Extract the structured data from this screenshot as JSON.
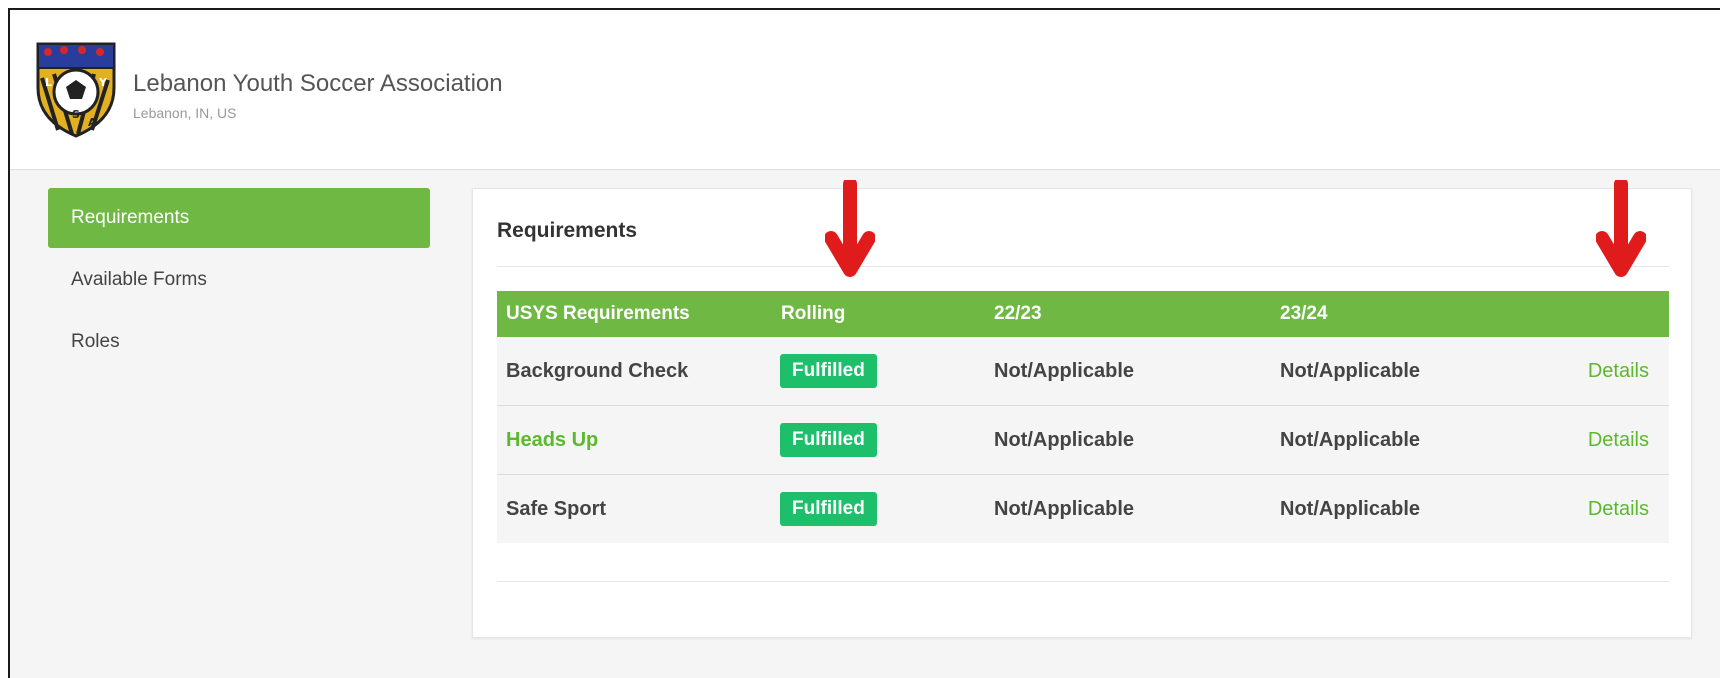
{
  "organization": {
    "name": "Lebanon Youth Soccer Association",
    "location": "Lebanon, IN, US",
    "logo_letters": [
      "L",
      "Y",
      "S",
      "A"
    ],
    "logo_icon": "soccer-ball-shield-icon"
  },
  "sidebar": {
    "items": [
      {
        "label": "Requirements",
        "active": true
      },
      {
        "label": "Available Forms",
        "active": false
      },
      {
        "label": "Roles",
        "active": false
      }
    ]
  },
  "panel": {
    "title": "Requirements",
    "table": {
      "headers": [
        "USYS Requirements",
        "Rolling",
        "22/23",
        "23/24",
        ""
      ],
      "rows": [
        {
          "name": "Background Check",
          "rolling": "Fulfilled",
          "s2223": "Not/Applicable",
          "s2324": "Not/Applicable",
          "action": "Details"
        },
        {
          "name": "Heads Up",
          "rolling": "Fulfilled",
          "s2223": "Not/Applicable",
          "s2324": "Not/Applicable",
          "action": "Details"
        },
        {
          "name": "Safe Sport",
          "rolling": "Fulfilled",
          "s2223": "Not/Applicable",
          "s2324": "Not/Applicable",
          "action": "Details"
        }
      ]
    }
  },
  "annotations": {
    "arrow_color": "#e01b1b",
    "arrow_icon": "down-arrow-icon"
  },
  "colors": {
    "brand_green": "#6fb843",
    "badge_green": "#1dbf6b",
    "link_green": "#5cb82e"
  }
}
